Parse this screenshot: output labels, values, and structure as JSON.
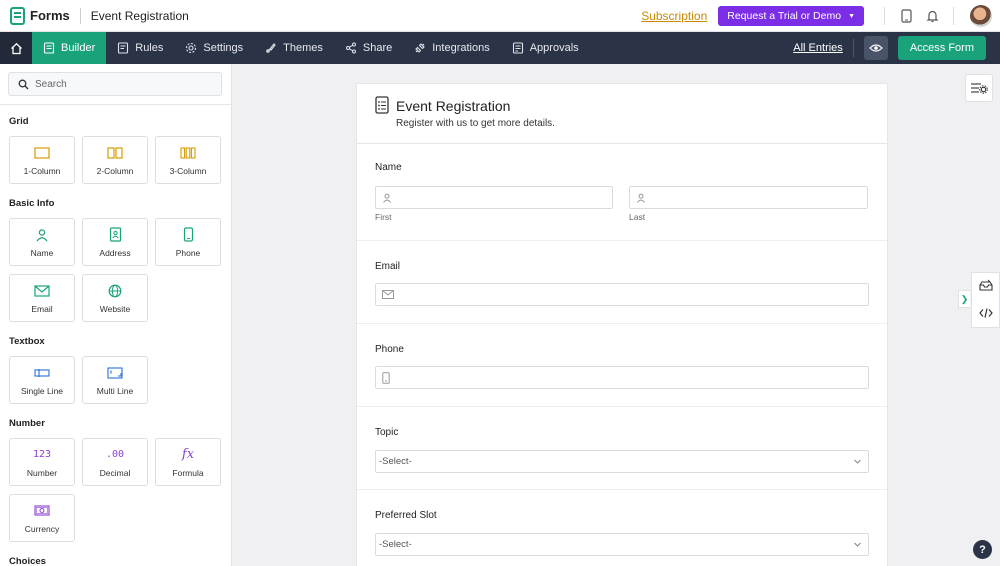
{
  "app": {
    "name": "Forms",
    "form_title": "Event Registration"
  },
  "topbar": {
    "subscription_label": "Subscription",
    "trial_label": "Request a Trial or Demo",
    "icons": [
      "mobile-icon",
      "bell-icon",
      "avatar"
    ]
  },
  "navbar": {
    "items": [
      {
        "label": "Builder",
        "icon": "builder-icon",
        "active": true
      },
      {
        "label": "Rules",
        "icon": "rules-icon"
      },
      {
        "label": "Settings",
        "icon": "gear-icon"
      },
      {
        "label": "Themes",
        "icon": "themes-icon"
      },
      {
        "label": "Share",
        "icon": "share-icon"
      },
      {
        "label": "Integrations",
        "icon": "integrations-icon"
      },
      {
        "label": "Approvals",
        "icon": "approvals-icon"
      }
    ],
    "all_entries_label": "All Entries",
    "access_form_label": "Access Form"
  },
  "sidebar": {
    "search_placeholder": "Search",
    "sections": {
      "grid": "Grid",
      "basic_info": "Basic Info",
      "textbox": "Textbox",
      "number": "Number",
      "choices": "Choices"
    },
    "tiles": {
      "one_column": "1-Column",
      "two_column": "2-Column",
      "three_column": "3-Column",
      "name": "Name",
      "address": "Address",
      "phone": "Phone",
      "email": "Email",
      "website": "Website",
      "single_line": "Single Line",
      "multi_line": "Multi Line",
      "number": "Number",
      "decimal": "Decimal",
      "formula": "Formula",
      "currency": "Currency",
      "number_glyph": "123",
      "decimal_glyph": ".00",
      "formula_glyph": "fx"
    }
  },
  "form": {
    "title": "Event Registration",
    "subtitle": "Register with us to get more details.",
    "fields": {
      "name_label": "Name",
      "first_sublabel": "First",
      "last_sublabel": "Last",
      "email_label": "Email",
      "phone_label": "Phone",
      "topic_label": "Topic",
      "topic_value": "-Select-",
      "slot_label": "Preferred Slot",
      "slot_value": "-Select-"
    }
  },
  "help_label": "?",
  "colors": {
    "accent": "#1aa37a",
    "nav_bg": "#2b3447",
    "trial": "#7b2ee6",
    "subscription": "#c98a00"
  }
}
